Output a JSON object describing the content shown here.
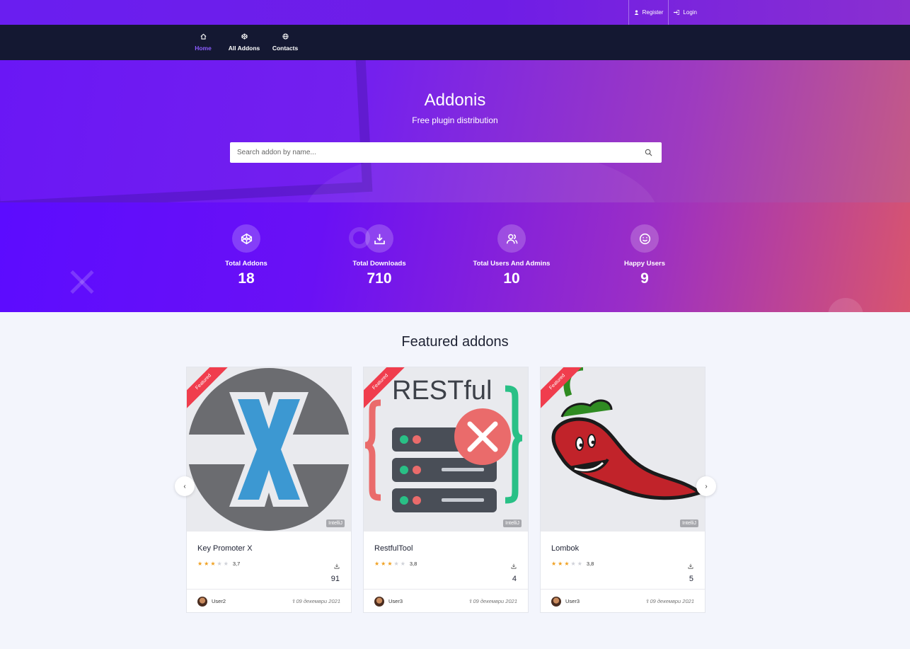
{
  "topbar": {
    "register_label": "Register",
    "login_label": "Login"
  },
  "nav": {
    "items": [
      {
        "label": "Home",
        "icon": "home-icon"
      },
      {
        "label": "All Addons",
        "icon": "codepen-icon"
      },
      {
        "label": "Contacts",
        "icon": "globe-icon"
      }
    ]
  },
  "hero": {
    "title": "Addonis",
    "subtitle": "Free plugin distribution",
    "search_placeholder": "Search addon by name..."
  },
  "stats": [
    {
      "label": "Total Addons",
      "value": "18",
      "icon": "codepen-icon"
    },
    {
      "label": "Total Downloads",
      "value": "710",
      "icon": "download-icon"
    },
    {
      "label": "Total Users And Admins",
      "value": "10",
      "icon": "users-icon"
    },
    {
      "label": "Happy Users",
      "value": "9",
      "icon": "smile-icon"
    }
  ],
  "featured": {
    "title": "Featured addons",
    "ribbon": "Featured",
    "cards": [
      {
        "name": "Key Promoter X",
        "ide": "IntelliJ",
        "rating": "3,7",
        "stars": 3,
        "downloads": "91",
        "user": "User2",
        "date": "09 декември 2021"
      },
      {
        "name": "RestfulTool",
        "ide": "IntelliJ",
        "rating": "3,8",
        "stars": 3,
        "downloads": "4",
        "user": "User3",
        "date": "09 декември 2021"
      },
      {
        "name": "Lombok",
        "ide": "IntelliJ",
        "rating": "3,8",
        "stars": 3,
        "downloads": "5",
        "user": "User3",
        "date": "09 декември 2021"
      }
    ],
    "restful_logo_text": "RESTful"
  },
  "colors": {
    "accent": "#8b5cff",
    "nav_bg": "#141832",
    "ribbon": "#f03d4d"
  }
}
